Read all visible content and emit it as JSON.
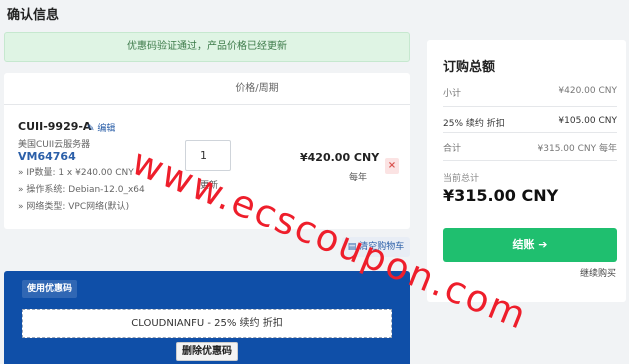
{
  "page": {
    "title": "确认信息"
  },
  "alert": {
    "text": "优惠码验证通过，产品价格已经更新"
  },
  "cart": {
    "header_price": "价格/周期",
    "product": {
      "name": "CUII-9929-A",
      "edit_label": "编辑",
      "group": "美国CUII云服务器",
      "hostname": "VM64764",
      "options": [
        "» IP数量: 1 x ¥240.00 CNY",
        "» 操作系统: Debian-12.0_x64",
        "» 网络类型: VPC网络(默认)"
      ],
      "quantity": "1",
      "update_label": "更新",
      "price": "¥420.00 CNY",
      "cycle": "每年",
      "remove_icon": "×"
    },
    "empty_cart_label": "清空购物车"
  },
  "promo": {
    "heading": "使用优惠码",
    "applied_code": "CLOUDNIANFU - 25% 续约 折扣",
    "remove_label": "删除优惠码"
  },
  "summary": {
    "title": "订购总额",
    "subtotal_label": "小计",
    "subtotal_value": "¥420.00 CNY",
    "discount_label": "25% 续约 折扣",
    "discount_value": "¥105.00 CNY",
    "total_label": "合计",
    "total_value": "¥315.00 CNY 每年",
    "due_label": "当前总计",
    "due_amount": "¥315.00 CNY",
    "checkout_label": "结账 ➔",
    "continue_label": "继续购买"
  },
  "watermark": {
    "text": "www.ecscoupon.com"
  },
  "colors": {
    "primary": "#0f4fa8",
    "success": "#1fbf6f",
    "watermark": "#ee1e2b"
  }
}
